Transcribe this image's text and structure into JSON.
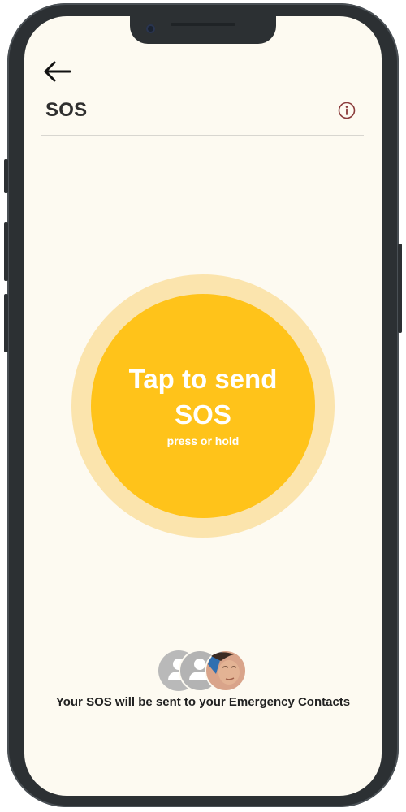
{
  "header": {
    "back_icon": "arrow-left-icon",
    "title": "SOS",
    "info_icon": "info-circle-icon"
  },
  "sos_button": {
    "main_label": "Tap to send SOS",
    "sub_label": "press or hold"
  },
  "contacts": {
    "icons": [
      "contact-placeholder-icon",
      "contact-placeholder-icon",
      "contact-avatar"
    ],
    "message": "Your SOS will be sent to your Emergency Contacts"
  },
  "colors": {
    "background": "#fdfaf1",
    "sos_primary": "#ffc31a",
    "sos_ring": "#fbe4ad",
    "text_dark": "#2f2f2f",
    "info_icon": "#8a3a3a"
  }
}
